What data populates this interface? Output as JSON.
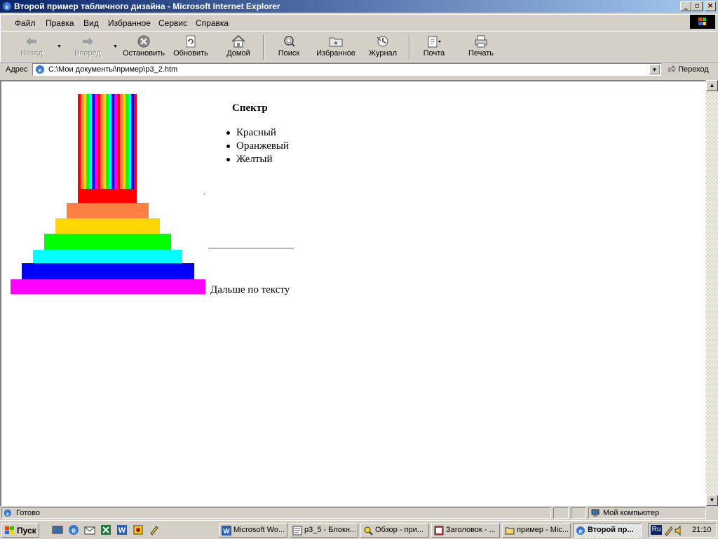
{
  "window": {
    "title": "Второй пример табличного дизайна - Microsoft Internet Explorer",
    "minimize": "_",
    "maximize": "▫",
    "close": "×"
  },
  "menu": [
    "Файл",
    "Правка",
    "Вид",
    "Избранное",
    "Сервис",
    "Справка"
  ],
  "toolbar": {
    "back": "Назад",
    "forward": "Вперед",
    "stop": "Остановить",
    "refresh": "Обновить",
    "home": "Домой",
    "search": "Поиск",
    "favorites": "Избранное",
    "history": "Журнал",
    "mail": "Почта",
    "print": "Печать"
  },
  "address": {
    "label": "Адрес",
    "value": "C:\\Мои документы\\пример\\р3_2.htm",
    "go": "Переход"
  },
  "page": {
    "heading": "Спектр",
    "list": [
      "Красный",
      "Оранжевый",
      "Желтый"
    ],
    "more_text": "Дальше по тексту",
    "stripe_colors": [
      "#ff0000",
      "#ff8040",
      "#ffd700",
      "#00ff00",
      "#00ffff",
      "#0000ff",
      "#ff00ff",
      "#ff0000",
      "#ff8040",
      "#ffd700",
      "#00ff00",
      "#00ffff",
      "#0000ff",
      "#ff00ff",
      "#ff0000",
      "#ff8040",
      "#ffd700",
      "#00ff00",
      "#00ffff",
      "#0000ff",
      "#ff0000"
    ],
    "step_colors": [
      "#ff0000",
      "#ff8040",
      "#ffd700",
      "#00ff00",
      "#00ffff",
      "#0000ff",
      "#ff00ff"
    ]
  },
  "status": {
    "text": "Готово",
    "zone": "Мой компьютер"
  },
  "taskbar": {
    "start": "Пуск",
    "tasks": [
      "Microsoft Wo...",
      "р3_5 - Блокн...",
      "Обзор - при...",
      "Заголовок - ...",
      "пример - Mic...",
      "Второй пр..."
    ],
    "lang": "Ru",
    "clock": "21:10"
  },
  "colors": {
    "titlebar_start": "#0a246a",
    "titlebar_end": "#a6caf0",
    "chrome": "#d4d0c8"
  }
}
